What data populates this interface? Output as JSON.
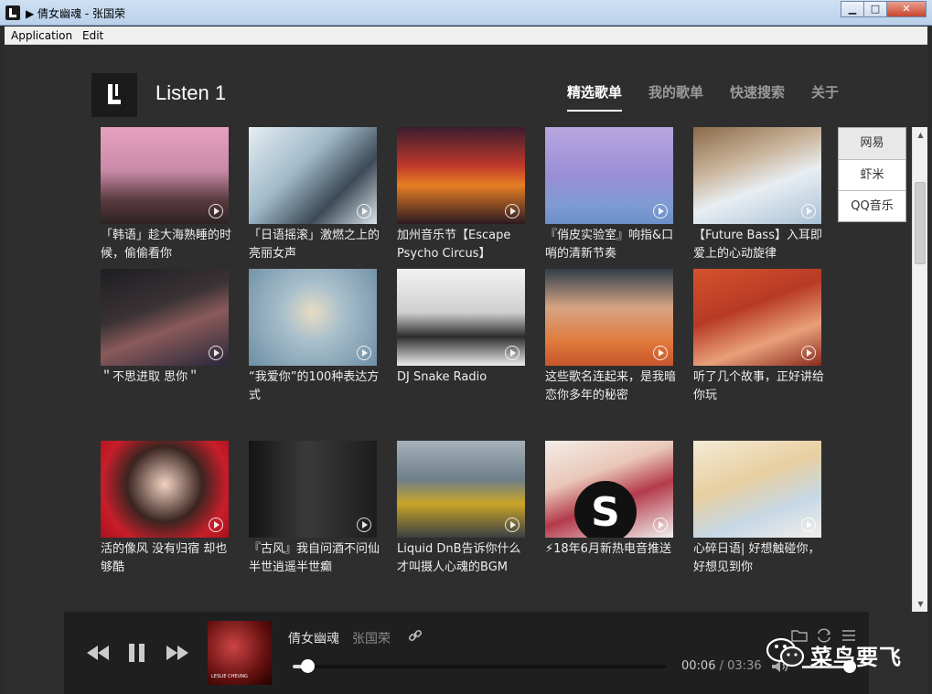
{
  "window": {
    "title": "▶ 倩女幽魂 - 张国荣",
    "controls": {
      "minimize": "▁",
      "maximize": "□",
      "close": "✕"
    }
  },
  "menubar": {
    "items": [
      "Application",
      "Edit"
    ]
  },
  "app": {
    "name": "Listen 1"
  },
  "nav": {
    "tabs": [
      "精选歌单",
      "我的歌单",
      "快速搜索",
      "关于"
    ],
    "active": 0
  },
  "sources": [
    "网易",
    "虾米",
    "QQ音乐"
  ],
  "playlists": [
    {
      "title": "「韩语」趁大海熟睡的时候，偷偷看你"
    },
    {
      "title": "「日语摇滚」激燃之上的亮丽女声"
    },
    {
      "title": "加州音乐节【Escape Psycho Circus】"
    },
    {
      "title": "『俏皮实验室』响指&口哨的清新节奏"
    },
    {
      "title": "【Future Bass】入耳即爱上的心动旋律"
    },
    {
      "title": "＂不思进取 思你＂"
    },
    {
      "title": "“我爱你”的100种表达方式"
    },
    {
      "title": "DJ Snake Radio"
    },
    {
      "title": "这些歌名连起来，是我暗恋你多年的秘密"
    },
    {
      "title": "听了几个故事，正好讲给你玩"
    },
    {
      "title": "活的像风 没有归宿 却也够酷"
    },
    {
      "title": "『古风』我自问酒不问仙 半世逍遥半世癫"
    },
    {
      "title": "Liquid DnB告诉你什么才叫摄人心魂的BGM"
    },
    {
      "title": "⚡18年6月新热电音推送"
    },
    {
      "title": "心碎日语| 好想触碰你，好想见到你"
    }
  ],
  "player": {
    "song": "倩女幽魂",
    "artist": "张国荣",
    "current_time": "00:06",
    "separator": "/",
    "total_time": "03:36",
    "progress": 0.028,
    "volume": 0.85
  },
  "watermark": {
    "text": "菜鸟要飞"
  }
}
